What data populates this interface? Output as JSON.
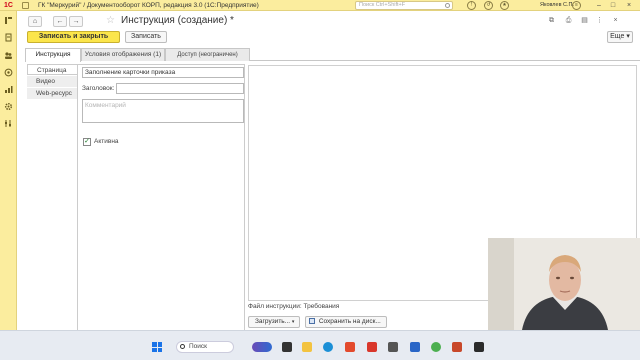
{
  "window": {
    "logo_text": "1С",
    "app_title": "ГК \"Меркурий\" / Документооборот КОРП, редакция 3.0  (1С:Предприятие)",
    "search_placeholder": "Поиск Ctrl+Shift+F",
    "user": "Яковлев С.П.",
    "minimize": "–",
    "maximize": "□",
    "close": "×"
  },
  "form": {
    "title": "Инструкция (создание) *",
    "nav_home": "⌂",
    "nav_back": "←",
    "nav_forward": "→",
    "favorite_star": "☆",
    "link_icon": "🔗",
    "print_icon": "⎙",
    "more_icon": "⋮",
    "close_icon": "×"
  },
  "toolbar": {
    "save_close": "Записать и закрыть",
    "save": "Записать",
    "more": "Еще ▾"
  },
  "tabs": [
    {
      "label": "Инструкция",
      "active": true
    },
    {
      "label": "Условия отображения (1)",
      "active": false
    },
    {
      "label": "Доступ (неограничен)",
      "active": false
    }
  ],
  "subtabs": [
    {
      "label": "Страница",
      "active": true
    },
    {
      "label": "Видео",
      "active": false
    },
    {
      "label": "Web-ресурс",
      "active": false
    }
  ],
  "page": {
    "name_value": "Заполнение карточки приказа",
    "title_label": "Заголовок:",
    "title_value": "",
    "comment_placeholder": "Комментарий",
    "active_label": "Активна",
    "active_checked": true,
    "file_label": "Файл инструкции:",
    "file_value": "Требования",
    "upload_button": "Загрузить...",
    "upload_arrow": "▾",
    "save_to_disk_button": "Сохранить на диск..."
  },
  "taskbar": {
    "search_label": "Поиск"
  },
  "colors": {
    "accent_yellow": "#fbe54b",
    "panel_yellow": "#fbed9e",
    "logo_red": "#d0021b"
  }
}
